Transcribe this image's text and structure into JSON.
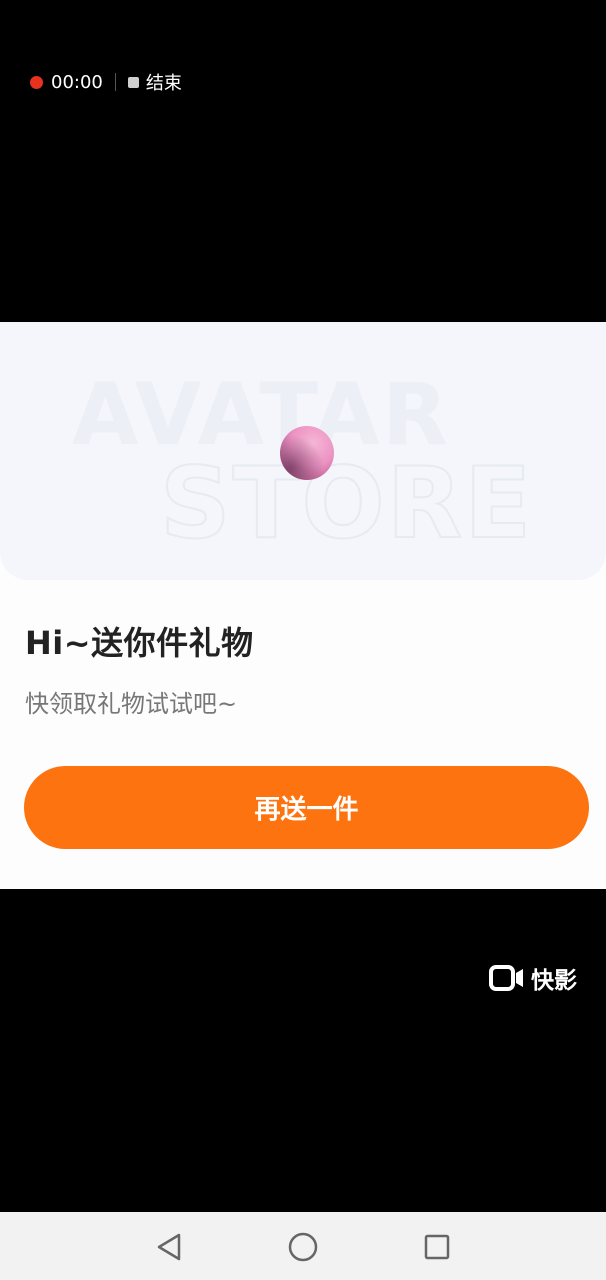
{
  "recording": {
    "timer": "00:00",
    "stop_label": "结束"
  },
  "banner": {
    "watermark_line1": "AVATAR",
    "watermark_line2": "STORE"
  },
  "gift": {
    "title": "Hi~送你件礼物",
    "subtitle": "快领取礼物试试吧~",
    "button_label": "再送一件",
    "button_color": "#fd730f"
  },
  "watermark": {
    "brand": "快影",
    "icon": "video-camera-icon"
  },
  "nav": {
    "back_icon": "back-triangle-icon",
    "home_icon": "home-circle-icon",
    "recents_icon": "recents-square-icon"
  }
}
